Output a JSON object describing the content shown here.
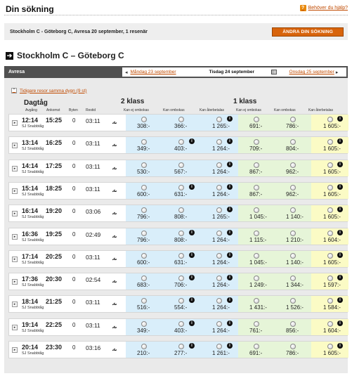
{
  "header": {
    "title": "Din sökning",
    "help_label": "Behöver du hjälp?",
    "help_icon": "?"
  },
  "search": {
    "summary": "Stockholm C - Göteborg C, Avresa 20 september, 1 resenär",
    "change_label": "ÄNDRA DIN SÖKNING"
  },
  "route": {
    "arrow_icon": "➔",
    "title": "Stockholm C – Göteborg C"
  },
  "bar": {
    "label": "Avresa",
    "prev_arrow": "◂",
    "prev_day": "Måndag 23 september",
    "current_day": "Tisdag 24 september",
    "next_day": "Onsdag 25 september",
    "next_arrow": "▸"
  },
  "earlier": {
    "icon": "⌃",
    "label": "Tidigare resor samma dygn (9 st)"
  },
  "table": {
    "train_header": "Dagtåg",
    "class2_header": "2 klass",
    "class1_header": "1 klass",
    "sub_avgang": "Avgång",
    "sub_ankomst": "Ankomst",
    "sub_byten": "Byten",
    "sub_restid": "Restid",
    "fare_types": [
      "Kan ej ombokas",
      "Kan ombokas",
      "Kan återbetalas",
      "Kan ej ombokas",
      "Kan ombokas",
      "Kan återbetalas"
    ],
    "info_symbol": "i",
    "play_symbol": "▸",
    "sj_symbol": "⩪",
    "rows": [
      {
        "dep": "12:14",
        "arr": "15:25",
        "chg": "0",
        "dur": "03:11",
        "op": "SJ Snabbtåg",
        "p": [
          "308:-",
          "366:-",
          "1 265:-",
          "691:-",
          "786:-",
          "1 605:-"
        ],
        "i": [
          false,
          false,
          true,
          false,
          false,
          true
        ]
      },
      {
        "dep": "13:14",
        "arr": "16:25",
        "chg": "0",
        "dur": "03:11",
        "op": "SJ Snabbtåg",
        "p": [
          "349:-",
          "403:-",
          "1 264:-",
          "709:-",
          "804:-",
          "1 605:-"
        ],
        "i": [
          false,
          true,
          true,
          false,
          false,
          true
        ]
      },
      {
        "dep": "14:14",
        "arr": "17:25",
        "chg": "0",
        "dur": "03:11",
        "op": "SJ Snabbtåg",
        "p": [
          "530:-",
          "567:-",
          "1 264:-",
          "867:-",
          "962:-",
          "1 605:-"
        ],
        "i": [
          false,
          false,
          true,
          false,
          false,
          true
        ]
      },
      {
        "dep": "15:14",
        "arr": "18:25",
        "chg": "0",
        "dur": "03:11",
        "op": "SJ Snabbtåg",
        "p": [
          "600:-",
          "631:-",
          "1 264:-",
          "867:-",
          "962:-",
          "1 605:-"
        ],
        "i": [
          false,
          true,
          true,
          false,
          false,
          true
        ]
      },
      {
        "dep": "16:14",
        "arr": "19:20",
        "chg": "0",
        "dur": "03:06",
        "op": "SJ Snabbtåg",
        "p": [
          "796:-",
          "808:-",
          "1 265:-",
          "1 045:-",
          "1 140:-",
          "1 605:-"
        ],
        "i": [
          false,
          false,
          true,
          false,
          false,
          true
        ]
      },
      {
        "dep": "16:36",
        "arr": "19:25",
        "chg": "0",
        "dur": "02:49",
        "op": "SJ Snabbtåg",
        "p": [
          "796:-",
          "808:-",
          "1 264:-",
          "1 115:-",
          "1 210:-",
          "1 604:-"
        ],
        "i": [
          false,
          true,
          true,
          false,
          false,
          true
        ]
      },
      {
        "dep": "17:14",
        "arr": "20:25",
        "chg": "0",
        "dur": "03:11",
        "op": "SJ Snabbtåg",
        "p": [
          "600:-",
          "631:-",
          "1 264:-",
          "1 045:-",
          "1 140:-",
          "1 605:-"
        ],
        "i": [
          false,
          true,
          true,
          false,
          false,
          true
        ]
      },
      {
        "dep": "17:36",
        "arr": "20:30",
        "chg": "0",
        "dur": "02:54",
        "op": "SJ Snabbtåg",
        "p": [
          "683:-",
          "706:-",
          "1 264:-",
          "1 249:-",
          "1 344:-",
          "1 597:-"
        ],
        "i": [
          false,
          true,
          true,
          false,
          false,
          true
        ]
      },
      {
        "dep": "18:14",
        "arr": "21:25",
        "chg": "0",
        "dur": "03:11",
        "op": "SJ Snabbtåg",
        "p": [
          "516:-",
          "554:-",
          "1 264:-",
          "1 431:-",
          "1 526:-",
          "1 584:-"
        ],
        "i": [
          false,
          true,
          true,
          false,
          false,
          true
        ]
      },
      {
        "dep": "19:14",
        "arr": "22:25",
        "chg": "0",
        "dur": "03:11",
        "op": "SJ Snabbtåg",
        "p": [
          "349:-",
          "403:-",
          "1 264:-",
          "761:-",
          "856:-",
          "1 604:-"
        ],
        "i": [
          false,
          true,
          true,
          false,
          false,
          true
        ]
      },
      {
        "dep": "20:14",
        "arr": "23:30",
        "chg": "0",
        "dur": "03:16",
        "op": "SJ Snabbtåg",
        "p": [
          "210:-",
          "277:-",
          "1 261:-",
          "691:-",
          "786:-",
          "1 605:-"
        ],
        "i": [
          false,
          true,
          true,
          false,
          false,
          true
        ]
      }
    ]
  }
}
